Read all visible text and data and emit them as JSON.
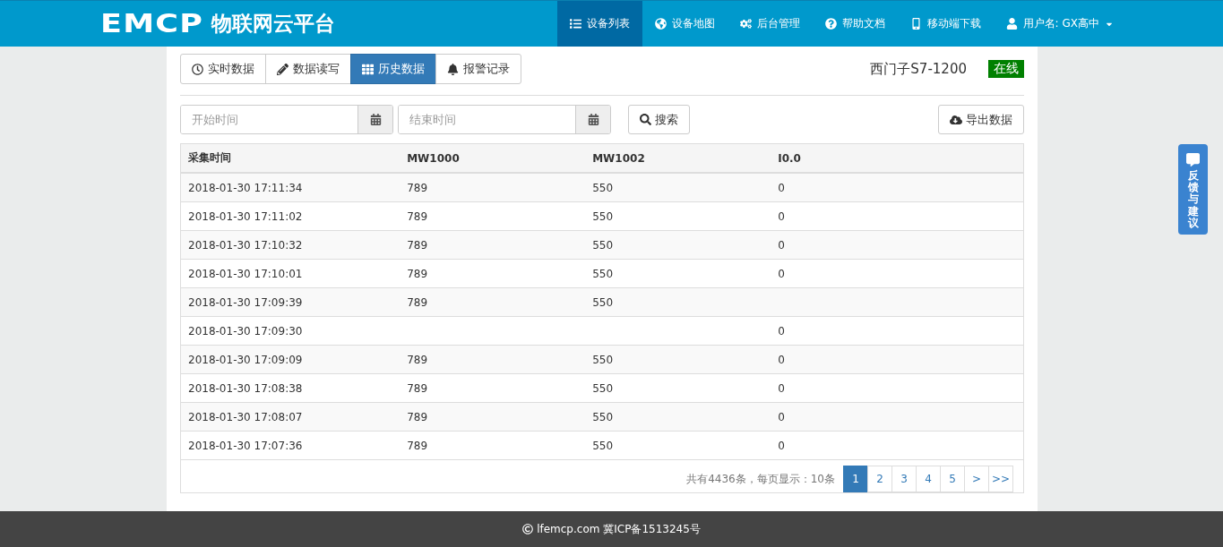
{
  "navbar": {
    "logo": "EMCP",
    "title": "物联网云平台",
    "items": [
      {
        "label": "设备列表",
        "selected": true
      },
      {
        "label": "设备地图",
        "selected": false
      },
      {
        "label": "后台管理",
        "selected": false
      },
      {
        "label": "帮助文档",
        "selected": false
      },
      {
        "label": "移动端下载",
        "selected": false
      },
      {
        "label": "用户名: GX高中",
        "selected": false,
        "dropdown": true
      }
    ]
  },
  "tabs": [
    {
      "label": "实时数据",
      "selected": false
    },
    {
      "label": "数据读写",
      "selected": false
    },
    {
      "label": "历史数据",
      "selected": true
    },
    {
      "label": "报警记录",
      "selected": false
    }
  ],
  "device": {
    "name": "西门子S7-1200",
    "status": "在线",
    "online": true
  },
  "filters": {
    "start": {
      "placeholder": "开始时间"
    },
    "end": {
      "placeholder": "结束时间"
    },
    "search": "搜索",
    "export": "导出数据"
  },
  "table": {
    "columns": [
      "采集时间",
      "MW1000",
      "MW1002",
      "I0.0"
    ],
    "rows": [
      [
        "2018-01-30 17:11:34",
        "789",
        "550",
        "0"
      ],
      [
        "2018-01-30 17:11:02",
        "789",
        "550",
        "0"
      ],
      [
        "2018-01-30 17:10:32",
        "789",
        "550",
        "0"
      ],
      [
        "2018-01-30 17:10:01",
        "789",
        "550",
        "0"
      ],
      [
        "2018-01-30 17:09:39",
        "789",
        "550",
        ""
      ],
      [
        "2018-01-30 17:09:30",
        "",
        "",
        "0"
      ],
      [
        "2018-01-30 17:09:09",
        "789",
        "550",
        "0"
      ],
      [
        "2018-01-30 17:08:38",
        "789",
        "550",
        "0"
      ],
      [
        "2018-01-30 17:08:07",
        "789",
        "550",
        "0"
      ],
      [
        "2018-01-30 17:07:36",
        "789",
        "550",
        "0"
      ]
    ]
  },
  "pagination": {
    "summary": "共有4436条，每页显示：10条",
    "pages": [
      {
        "label": "1",
        "selected": true
      },
      {
        "label": "2",
        "selected": false
      },
      {
        "label": "3",
        "selected": false
      },
      {
        "label": "4",
        "selected": false
      },
      {
        "label": "5",
        "selected": false
      },
      {
        "label": ">",
        "selected": false
      },
      {
        "label": ">>",
        "selected": false
      }
    ]
  },
  "feedback": "反馈与建议",
  "footer": "lfemcp.com 冀ICP备1513245号"
}
